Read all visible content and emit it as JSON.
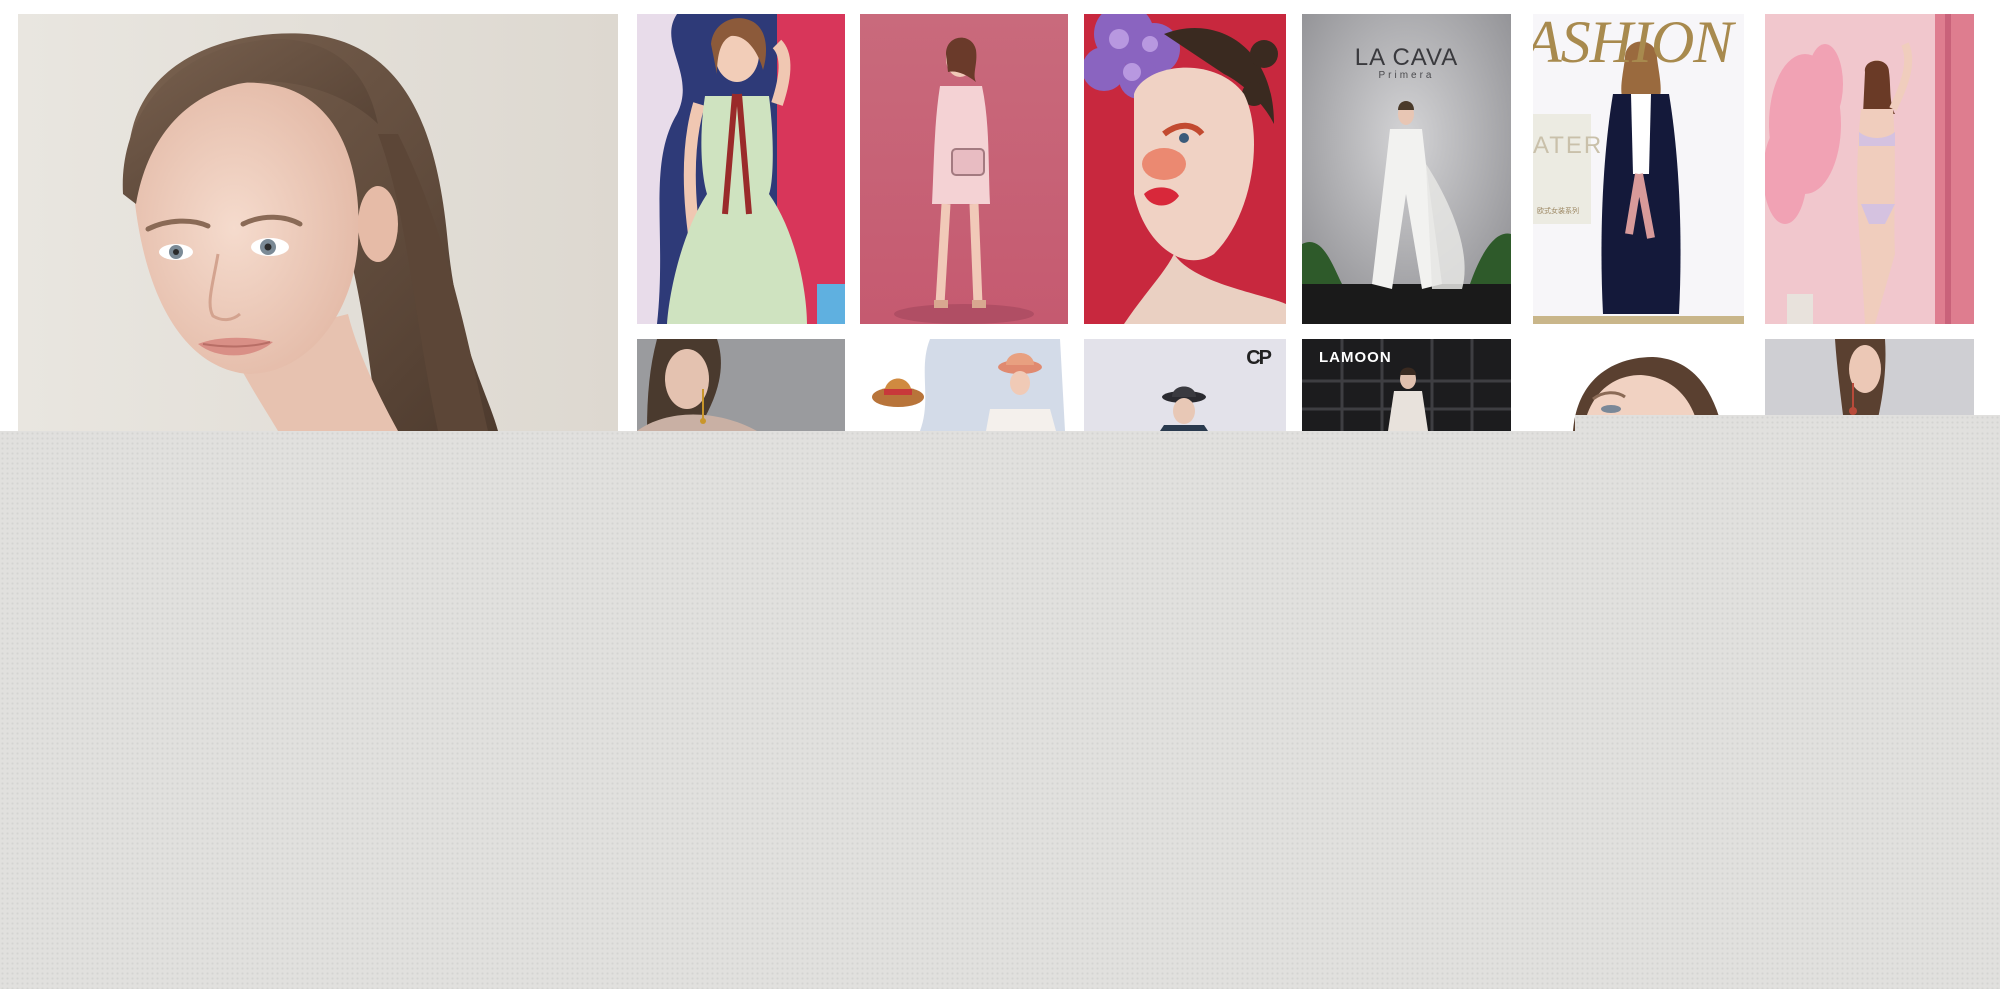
{
  "gallery": {
    "tiles": [
      {
        "id": "hero",
        "subject": "close-up portrait, long brown hair"
      },
      {
        "id": "r1c1",
        "subject": "mint dress with red ribbon"
      },
      {
        "id": "r1c2",
        "subject": "pink mini dress with handbag"
      },
      {
        "id": "r1c3",
        "subject": "red makeup with purple flowers"
      },
      {
        "id": "r1c4",
        "subject": "white gown on stage",
        "brand": "LA CAVA",
        "sub": "Primera"
      },
      {
        "id": "r1c5",
        "subject": "navy long cardigan",
        "headline": "ASHION",
        "side_text": "ATER",
        "small_text": "欧式女装系列"
      },
      {
        "id": "r1c6",
        "subject": "lingerie with pink feathers"
      },
      {
        "id": "r2c1",
        "subject": "model with earrings, grey backdrop"
      },
      {
        "id": "r2c2",
        "subject": "straw hats, floral backdrop"
      },
      {
        "id": "r2c3",
        "subject": "model in black hat",
        "logo_text": "CP"
      },
      {
        "id": "r2c4",
        "subject": "lace dress, dark window",
        "brand": "LAMOON"
      },
      {
        "id": "r2c5",
        "subject": "beauty close-up"
      },
      {
        "id": "r2c6",
        "subject": "model with drop earrings"
      }
    ]
  },
  "colors": {
    "overlay": "#e1e0de",
    "hero_bg": "#e6e2dc",
    "hair": "#6a5443",
    "skin": "#f0d2c2"
  }
}
